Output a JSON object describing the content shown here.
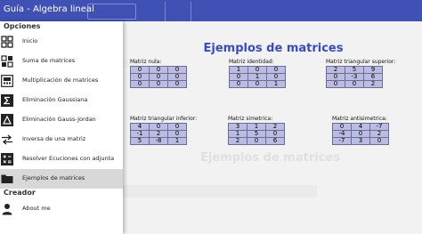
{
  "app": {
    "title": "Guía - Algebra lineal"
  },
  "drawer": {
    "section_options": "Opciones",
    "section_creator": "Creador",
    "items": [
      {
        "label": "Inicio",
        "icon": "grid-icon"
      },
      {
        "label": "Suma de matrices",
        "icon": "plus-squares-icon"
      },
      {
        "label": "Multiplicación de matrices",
        "icon": "matrix-calc-icon"
      },
      {
        "label": "Eliminación Gaussiana",
        "icon": "sigma-icon"
      },
      {
        "label": "Eliminación Gauss-Jordan",
        "icon": "triangle-icon"
      },
      {
        "label": "Inversa de una matriz",
        "icon": "swap-arrows-icon"
      },
      {
        "label": "Resolver Ecuciones con adjunta",
        "icon": "calculator-icon"
      },
      {
        "label": "Ejemplos de matrices",
        "icon": "folder-icon",
        "selected": true
      },
      {
        "label": "About me",
        "icon": "person-icon"
      }
    ]
  },
  "main": {
    "heading": "Ejemplos de matrices",
    "background_heading": "Ejemplos de matrices",
    "matrices": [
      {
        "label": "Matriz nula:",
        "rows": [
          [
            "0",
            "0",
            "0"
          ],
          [
            "0",
            "0",
            "0"
          ],
          [
            "0",
            "0",
            "0"
          ]
        ]
      },
      {
        "label": "Matriz identidad:",
        "rows": [
          [
            "1",
            "0",
            "0"
          ],
          [
            "0",
            "1",
            "0"
          ],
          [
            "0",
            "0",
            "1"
          ]
        ]
      },
      {
        "label": "Matriz triangular superior:",
        "rows": [
          [
            "2",
            "5",
            "9"
          ],
          [
            "0",
            "-3",
            "6"
          ],
          [
            "0",
            "0",
            "2"
          ]
        ]
      },
      {
        "label": "Matriz triangular inferior:",
        "rows": [
          [
            "4",
            "0",
            "0"
          ],
          [
            "-1",
            "2",
            "0"
          ],
          [
            "5",
            "-8",
            "1"
          ]
        ]
      },
      {
        "label": "Matriz simetrica:",
        "rows": [
          [
            "3",
            "1",
            "2"
          ],
          [
            "1",
            "5",
            "0"
          ],
          [
            "2",
            "0",
            "6"
          ]
        ]
      },
      {
        "label": "Matriz antisimetrica:",
        "rows": [
          [
            "0",
            "4",
            "-7"
          ],
          [
            "-4",
            "0",
            "2"
          ],
          [
            "-7",
            "3",
            "0"
          ]
        ]
      }
    ]
  }
}
